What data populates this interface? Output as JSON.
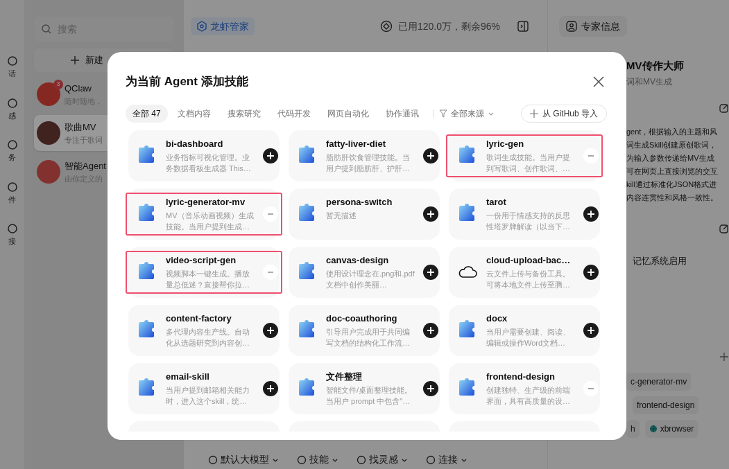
{
  "rail": {
    "items": [
      {
        "label": "话"
      },
      {
        "label": "感"
      },
      {
        "label": "务"
      },
      {
        "label": "件"
      },
      {
        "label": "接"
      }
    ]
  },
  "sidebar": {
    "search_placeholder": "搜索",
    "new_button": "新建",
    "agents": [
      {
        "name": "QClaw",
        "subtitle": "随时随地，",
        "badge": "3",
        "selected": false
      },
      {
        "name": "歌曲MV",
        "subtitle": "专注于歌词",
        "selected": true
      },
      {
        "name": "智能Agent",
        "subtitle": "由你定义的",
        "selected": false
      }
    ]
  },
  "header": {
    "agent_tag": "龙虾管家",
    "usage": "已用120.0万，剩余96%",
    "expert_button": "专家信息"
  },
  "right_panel": {
    "title": "MV传作大师",
    "subtitle": "词和MV生成",
    "description_lines": [
      "gent，根据输入的主题和风",
      "词生成Skill创建原创歌词，",
      "为输入参数传递给MV生成",
      "可在网页上直接浏览的交互",
      "kill通过标准化JSON格式进",
      "内容连贯性和风格一致性。"
    ],
    "memory_label": "记忆系统启用",
    "tag_rows": [
      [
        {
          "label": "c-generator-mv"
        }
      ],
      [
        {
          "label": "frontend-design"
        }
      ],
      [
        {
          "label": "h"
        },
        {
          "label": "xbrowser",
          "kind": "globe"
        }
      ]
    ]
  },
  "composer": {
    "toolbar": [
      {
        "label": "默认大模型"
      },
      {
        "label": "技能"
      },
      {
        "label": "找灵感"
      },
      {
        "label": "连接"
      }
    ]
  },
  "dialog": {
    "title": "为当前 Agent 添加技能",
    "tabs": [
      {
        "label": "全部",
        "count": "47",
        "selected": true
      },
      {
        "label": "文档内容",
        "selected": false
      },
      {
        "label": "搜索研究",
        "selected": false
      },
      {
        "label": "代码开发",
        "selected": false
      },
      {
        "label": "网页自动化",
        "selected": false
      },
      {
        "label": "协作通讯",
        "selected": false
      }
    ],
    "source_filter": "全部来源",
    "import_button": "从 GitHub 导入",
    "skills": [
      {
        "name": "bi-dashboard",
        "description": "业务指标可视化管理。业务数据看板生成器 This…",
        "kind": "puzzle",
        "added": false,
        "highlighted": false
      },
      {
        "name": "fatty-liver-diet",
        "description": "脂肪肝饮食管理技能。当用户提到脂肪肝、护肝…",
        "kind": "puzzle",
        "added": false,
        "highlighted": false
      },
      {
        "name": "lyric-gen",
        "description": "歌词生成技能。当用户提到写歌词、创作歌词、…",
        "kind": "puzzle",
        "added": true,
        "highlighted": true
      },
      {
        "name": "lyric-generator-mv",
        "description": "MV（音乐动画视频）生成技能。当用户提到生成…",
        "kind": "puzzle",
        "added": true,
        "highlighted": true
      },
      {
        "name": "persona-switch",
        "description": "暂无描述",
        "kind": "puzzle",
        "added": false,
        "highlighted": false
      },
      {
        "name": "tarot",
        "description": "一份用于情感支持的反思性塔罗牌解读（以当下…",
        "kind": "puzzle",
        "added": false,
        "highlighted": false
      },
      {
        "name": "video-script-gen",
        "description": "视频脚本一键生成。播放量总低迷？直接帮你拉…",
        "kind": "puzzle",
        "added": true,
        "highlighted": true
      },
      {
        "name": "canvas-design",
        "description": "使用设计理念在.png和.pdf文档中创作美丽…",
        "kind": "puzzle",
        "added": false,
        "highlighted": false
      },
      {
        "name": "cloud-upload-bac…",
        "description": "云文件上传与备份工具。可将本地文件上传至腾…",
        "kind": "cloud",
        "added": false,
        "highlighted": false
      },
      {
        "name": "content-factory",
        "description": "多代理内容生产线。自动化从选题研究到内容创…",
        "kind": "puzzle",
        "added": false,
        "highlighted": false
      },
      {
        "name": "doc-coauthoring",
        "description": "引导用户完成用于共同编写文档的结构化工作流…",
        "kind": "puzzle",
        "added": false,
        "highlighted": false
      },
      {
        "name": "docx",
        "description": "当用户需要创建、阅读、编辑或操作Word文档…",
        "kind": "puzzle",
        "added": false,
        "highlighted": false
      },
      {
        "name": "email-skill",
        "description": "当用户提到邮箱相关能力时，进入这个skill，统…",
        "kind": "puzzle",
        "added": false,
        "highlighted": false
      },
      {
        "name": "文件整理",
        "description": "智能文件/桌面整理技能。当用户 prompt 中包含\"…",
        "kind": "puzzle",
        "added": false,
        "highlighted": false
      },
      {
        "name": "frontend-design",
        "description": "创建独特、生产级的前端界面，具有高质量的设…",
        "kind": "puzzle",
        "added": true,
        "highlighted": false
      }
    ]
  }
}
